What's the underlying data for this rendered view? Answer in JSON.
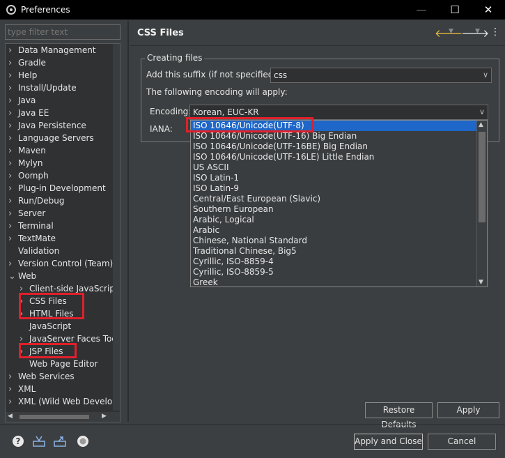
{
  "window": {
    "title": "Preferences"
  },
  "filter": {
    "placeholder": "type filter text"
  },
  "tree": [
    {
      "label": "Data Management",
      "expanded": false,
      "indent": 0
    },
    {
      "label": "Gradle",
      "expanded": false,
      "indent": 0
    },
    {
      "label": "Help",
      "expanded": false,
      "indent": 0
    },
    {
      "label": "Install/Update",
      "expanded": false,
      "indent": 0
    },
    {
      "label": "Java",
      "expanded": false,
      "indent": 0
    },
    {
      "label": "Java EE",
      "expanded": false,
      "indent": 0
    },
    {
      "label": "Java Persistence",
      "expanded": false,
      "indent": 0
    },
    {
      "label": "Language Servers",
      "expanded": false,
      "indent": 0
    },
    {
      "label": "Maven",
      "expanded": false,
      "indent": 0
    },
    {
      "label": "Mylyn",
      "expanded": false,
      "indent": 0
    },
    {
      "label": "Oomph",
      "expanded": false,
      "indent": 0
    },
    {
      "label": "Plug-in Development",
      "expanded": false,
      "indent": 0
    },
    {
      "label": "Run/Debug",
      "expanded": false,
      "indent": 0
    },
    {
      "label": "Server",
      "expanded": false,
      "indent": 0
    },
    {
      "label": "Terminal",
      "expanded": false,
      "indent": 0
    },
    {
      "label": "TextMate",
      "expanded": false,
      "indent": 0
    },
    {
      "label": "Validation",
      "expanded": null,
      "indent": 0
    },
    {
      "label": "Version Control (Team)",
      "expanded": false,
      "indent": 0
    },
    {
      "label": "Web",
      "expanded": true,
      "indent": 0
    },
    {
      "label": "Client-side JavaScript",
      "expanded": false,
      "indent": 1
    },
    {
      "label": "CSS Files",
      "expanded": false,
      "indent": 1
    },
    {
      "label": "HTML Files",
      "expanded": false,
      "indent": 1
    },
    {
      "label": "JavaScript",
      "expanded": null,
      "indent": 1
    },
    {
      "label": "JavaServer Faces Tools",
      "expanded": false,
      "indent": 1
    },
    {
      "label": "JSP Files",
      "expanded": false,
      "indent": 1
    },
    {
      "label": "Web Page Editor",
      "expanded": null,
      "indent": 1
    },
    {
      "label": "Web Services",
      "expanded": false,
      "indent": 0
    },
    {
      "label": "XML",
      "expanded": false,
      "indent": 0
    },
    {
      "label": "XML (Wild Web Developer)",
      "expanded": false,
      "indent": 0
    }
  ],
  "page": {
    "title": "CSS Files",
    "group_title": "Creating files",
    "suffix_label": "Add this suffix (if not specified):",
    "suffix_value": "css",
    "encoding_note": "The following encoding will apply:",
    "encoding_label": "Encoding:",
    "encoding_value": "Korean, EUC-KR",
    "iana_label": "IANA:"
  },
  "encoding_options": [
    "ISO 10646/Unicode(UTF-8)",
    "ISO 10646/Unicode(UTF-16) Big Endian",
    "ISO 10646/Unicode(UTF-16BE) Big Endian",
    "ISO 10646/Unicode(UTF-16LE) Little Endian",
    "US ASCII",
    "ISO Latin-1",
    "ISO Latin-9",
    "Central/East European (Slavic)",
    "Southern European",
    "Arabic, Logical",
    "Arabic",
    "Chinese, National Standard",
    "Traditional Chinese, Big5",
    "Cyrillic, ISO-8859-4",
    "Cyrillic, ISO-8859-5",
    "Greek"
  ],
  "selected_encoding_index": 0,
  "buttons": {
    "restore_defaults": "Restore Defaults",
    "apply": "Apply",
    "apply_and_close": "Apply and Close",
    "cancel": "Cancel"
  },
  "colors": {
    "selection": "#1e66c8",
    "highlight_box": "#e0202a",
    "background": "#3c3f41"
  }
}
